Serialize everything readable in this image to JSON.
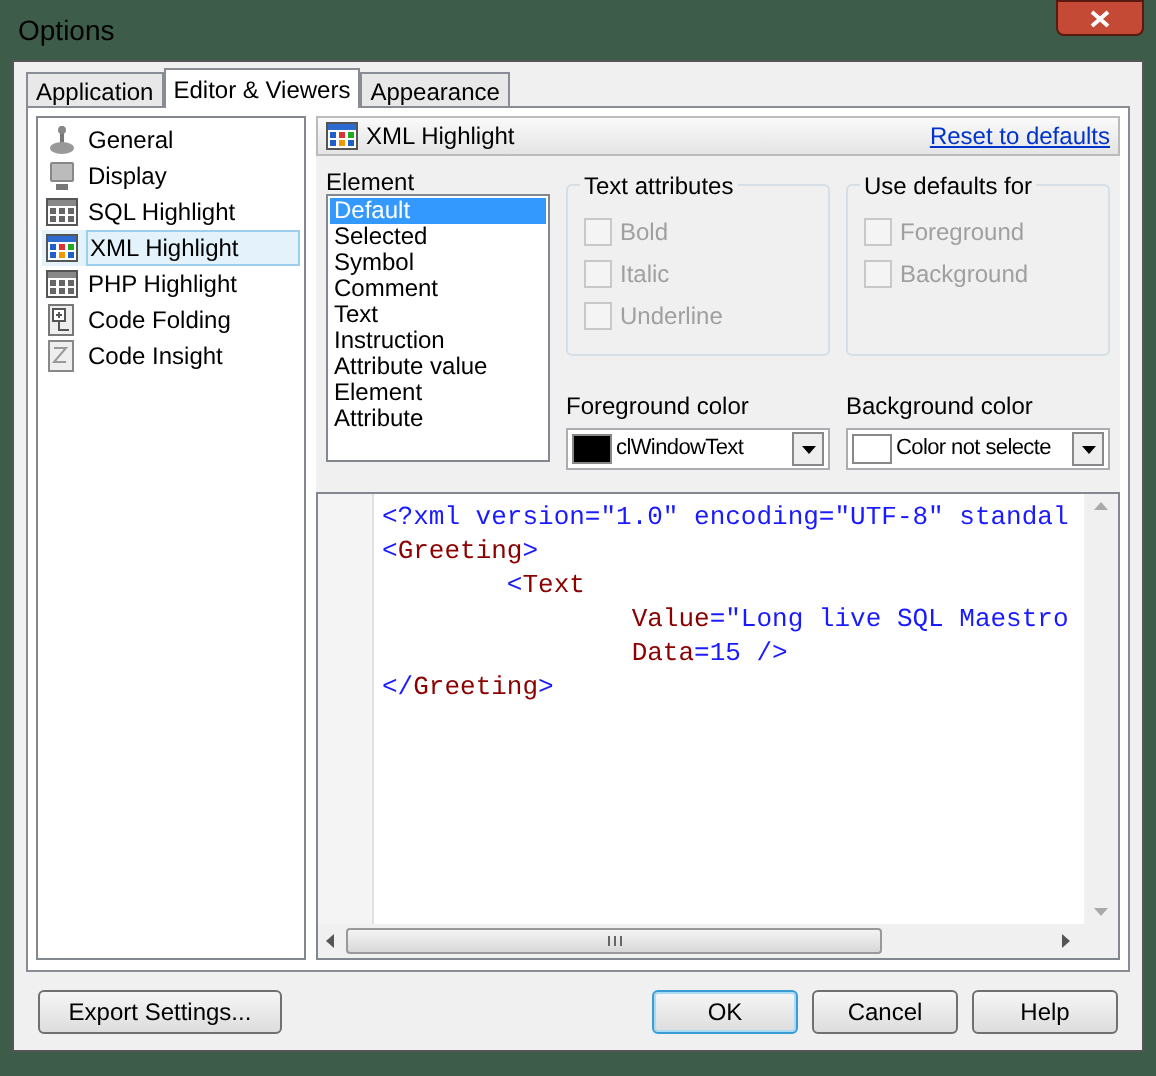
{
  "window": {
    "title": "Options"
  },
  "tabs": [
    {
      "label": "Application",
      "selected": false
    },
    {
      "label": "Editor & Viewers",
      "selected": true
    },
    {
      "label": "Appearance",
      "selected": false
    }
  ],
  "sidebar": {
    "items": [
      {
        "label": "General",
        "kind": "general",
        "selected": false
      },
      {
        "label": "Display",
        "kind": "display",
        "selected": false
      },
      {
        "label": "SQL Highlight",
        "kind": "grid",
        "selected": false
      },
      {
        "label": "XML Highlight",
        "kind": "grid-color",
        "selected": true
      },
      {
        "label": "PHP Highlight",
        "kind": "grid",
        "selected": false
      },
      {
        "label": "Code Folding",
        "kind": "folding",
        "selected": false
      },
      {
        "label": "Code Insight",
        "kind": "insight",
        "selected": false
      }
    ]
  },
  "page_header": {
    "title": "XML Highlight",
    "link": "Reset to defaults"
  },
  "element": {
    "label": "Element",
    "items": [
      {
        "label": "Default",
        "selected": true
      },
      {
        "label": "Selected",
        "selected": false
      },
      {
        "label": "Symbol",
        "selected": false
      },
      {
        "label": "Comment",
        "selected": false
      },
      {
        "label": "Text",
        "selected": false
      },
      {
        "label": "Instruction",
        "selected": false
      },
      {
        "label": "Attribute value",
        "selected": false
      },
      {
        "label": "Element",
        "selected": false
      },
      {
        "label": "Attribute",
        "selected": false
      }
    ]
  },
  "text_attributes": {
    "title": "Text attributes",
    "options": [
      {
        "label": "Bold",
        "checked": false,
        "disabled": true
      },
      {
        "label": "Italic",
        "checked": false,
        "disabled": true
      },
      {
        "label": "Underline",
        "checked": false,
        "disabled": true
      }
    ]
  },
  "use_defaults_for": {
    "title": "Use defaults for",
    "options": [
      {
        "label": "Foreground",
        "checked": false,
        "disabled": true
      },
      {
        "label": "Background",
        "checked": false,
        "disabled": true
      }
    ]
  },
  "foreground_color": {
    "label": "Foreground color",
    "value": "clWindowText",
    "color": "#000000"
  },
  "background_color": {
    "label": "Background color",
    "value": "Color not selecte",
    "color": "#ffffff"
  },
  "code_preview": {
    "lines": [
      [
        {
          "kind": "punct",
          "text": "<?xml version=\"1.0\" encoding=\"UTF-8\" standal"
        }
      ],
      [
        {
          "kind": "punct",
          "text": "<"
        },
        {
          "kind": "name",
          "text": "Greeting"
        },
        {
          "kind": "punct",
          "text": ">"
        }
      ],
      [
        {
          "kind": "punct",
          "text": "        <"
        },
        {
          "kind": "name",
          "text": "Text"
        }
      ],
      [
        {
          "kind": "name",
          "text": "                Value"
        },
        {
          "kind": "punct",
          "text": "=\"Long live SQL Maestro"
        }
      ],
      [
        {
          "kind": "name",
          "text": "                Data"
        },
        {
          "kind": "punct",
          "text": "=15 />"
        }
      ],
      [
        {
          "kind": "punct",
          "text": "</"
        },
        {
          "kind": "name",
          "text": "Greeting"
        },
        {
          "kind": "punct",
          "text": ">"
        }
      ]
    ]
  },
  "buttons": [
    {
      "label": "Export Settings...",
      "kind": "secondary"
    },
    {
      "label": "OK",
      "kind": "default"
    },
    {
      "label": "Cancel",
      "kind": "normal"
    },
    {
      "label": "Help",
      "kind": "normal"
    }
  ]
}
